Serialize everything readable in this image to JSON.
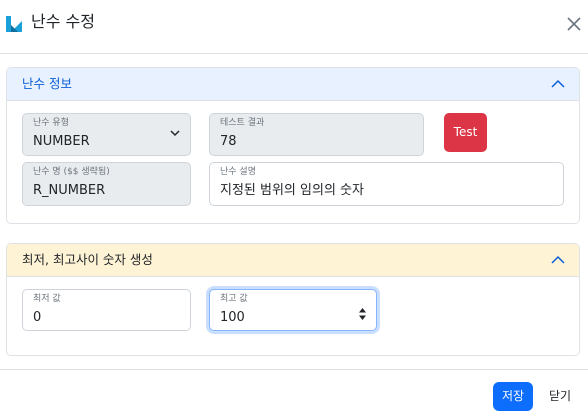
{
  "dialog": {
    "title": "난수 수정",
    "icon": "logo-icon",
    "close_icon": "close-icon"
  },
  "section_info": {
    "title": "난수 정보",
    "icon": "chevron-up-icon",
    "type_field": {
      "label": "난수 유형",
      "value": "NUMBER",
      "icon": "chevron-down-icon"
    },
    "name_field": {
      "label": "난수 명 ($$ 생략됨)",
      "value": "R_NUMBER"
    },
    "test_result": {
      "label": "테스트 결과",
      "value": "78"
    },
    "description": {
      "label": "난수 설명",
      "value": "지정된 범위의 임의의 숫자"
    },
    "test_button": "Test"
  },
  "section_range": {
    "title": "최저, 최고사이 숫자 생성",
    "icon": "chevron-up-icon",
    "min_field": {
      "label": "최저 값",
      "value": "0"
    },
    "max_field": {
      "label": "최고 값",
      "value": "100",
      "icon": "spinner-icon"
    }
  },
  "footer": {
    "save_label": "저장",
    "close_label": "닫기"
  },
  "colors": {
    "primary": "#0d6efd",
    "danger": "#dc3545",
    "info_header_bg": "#e7f1ff",
    "range_header_bg": "#fff3d6",
    "logo_blue": "#1a9fd9"
  }
}
